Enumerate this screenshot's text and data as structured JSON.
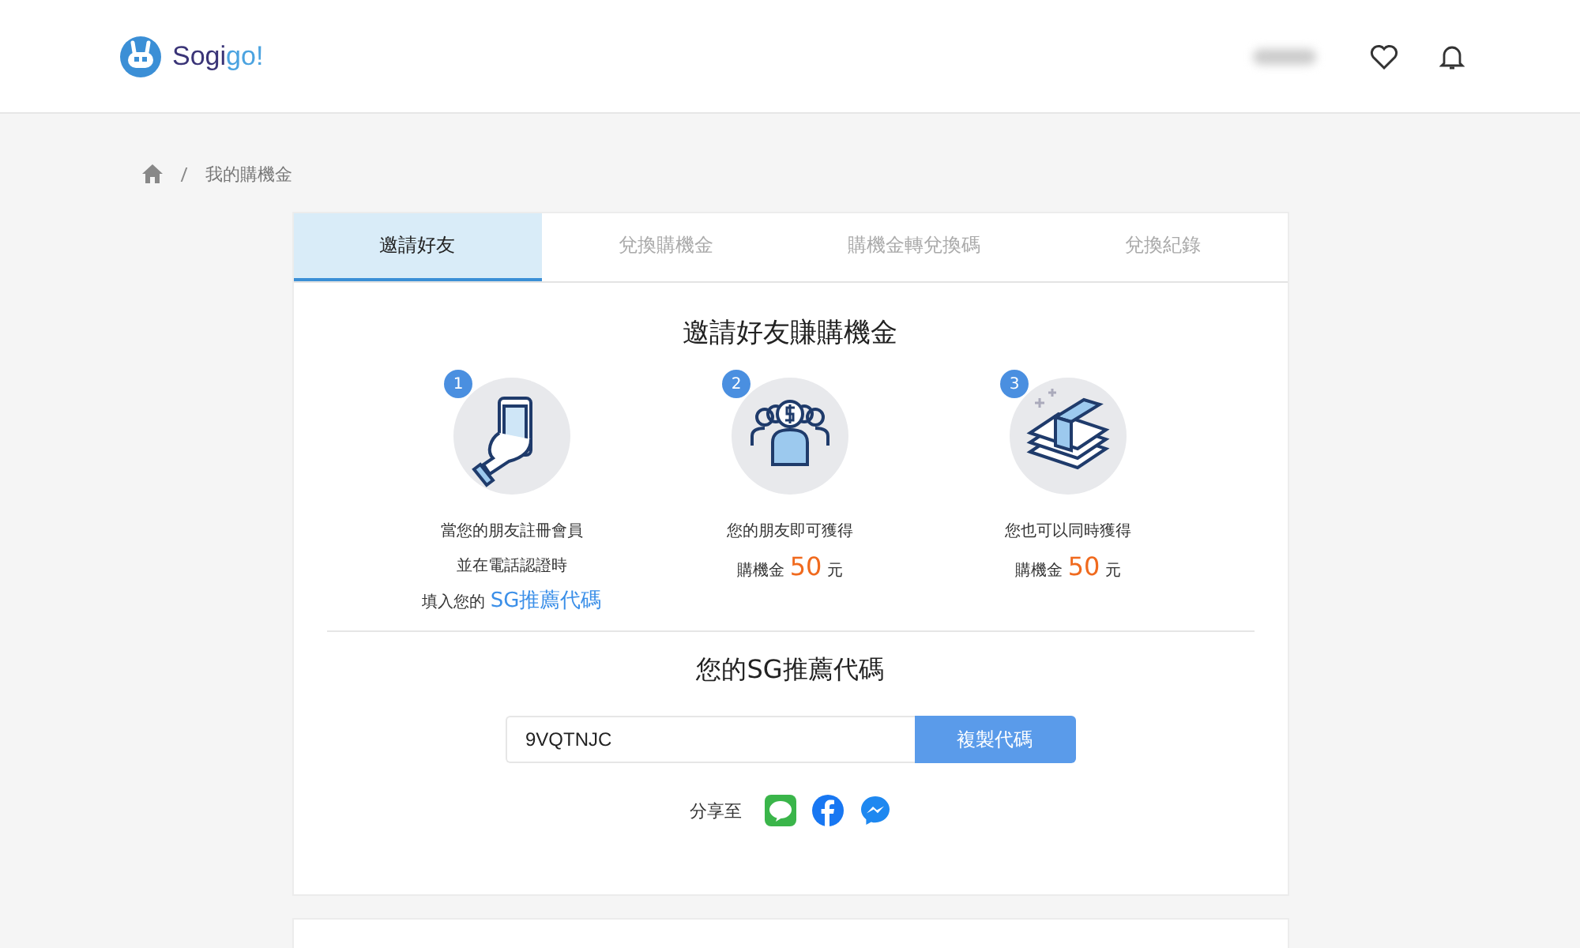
{
  "header": {
    "logo": [
      "Sogi",
      "go!"
    ]
  },
  "breadcrumb": [
    "我的購機金"
  ],
  "tabs": [
    {
      "label": "邀請好友",
      "selected": true
    },
    {
      "label": "兌換購機金",
      "selected": false
    },
    {
      "label": "購機金轉兌換碼",
      "selected": false
    },
    {
      "label": "兌換紀錄",
      "selected": false
    }
  ],
  "title": "邀請好友賺購機金",
  "steps": [
    {
      "number": "1",
      "kind": "phone",
      "lines": [
        [
          {
            "kind": "plain",
            "text": "當您的朋友註冊會員"
          }
        ],
        [
          {
            "kind": "plain",
            "text": "並在電話認證時"
          }
        ],
        [
          {
            "kind": "plain",
            "text": "填入您的 "
          },
          {
            "kind": "link",
            "text": "SG推薦代碼"
          }
        ]
      ]
    },
    {
      "number": "2",
      "kind": "people",
      "lines": [
        [
          {
            "kind": "plain",
            "text": "您的朋友即可獲得"
          }
        ],
        [
          {
            "kind": "plain",
            "text": "購機金 "
          },
          {
            "kind": "amount",
            "text": "50"
          },
          {
            "kind": "plain",
            "text": " 元"
          }
        ]
      ]
    },
    {
      "number": "3",
      "kind": "money",
      "lines": [
        [
          {
            "kind": "plain",
            "text": "您也可以同時獲得"
          }
        ],
        [
          {
            "kind": "plain",
            "text": "購機金 "
          },
          {
            "kind": "amount",
            "text": "50"
          },
          {
            "kind": "plain",
            "text": " 元"
          }
        ]
      ]
    }
  ],
  "code_section": {
    "title": "您的SG推薦代碼",
    "code": "9VQTNJC",
    "button": "複製代碼",
    "share_label": "分享至",
    "share": [
      {
        "kind": "line"
      },
      {
        "kind": "facebook"
      },
      {
        "kind": "messenger"
      }
    ]
  }
}
